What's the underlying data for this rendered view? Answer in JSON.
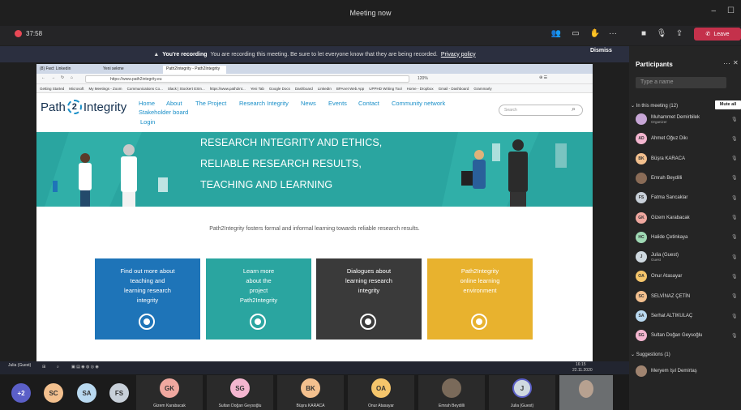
{
  "window": {
    "title": "Meeting now"
  },
  "meeting_bar": {
    "timer": "37:58",
    "leave_label": "Leave"
  },
  "banner": {
    "title": "You're recording",
    "text": "You are recording this meeting. Be sure to let everyone know that they are being recorded.",
    "link": "Privacy policy",
    "dismiss": "Dismiss"
  },
  "browser": {
    "tabs": [
      "(8) Fwd: Linkedin",
      "Yeni sekme",
      "Path2Integrity - Path2Integrity"
    ],
    "url": "https://www.path2integrity.eu",
    "zoom": "120%",
    "bookmarks": [
      "Getting Started",
      "Microsoft",
      "My Meetings - Zoom",
      "Communications Co...",
      "Slack | Stockert ESIn...",
      "https://www.path2int...",
      "Yeni Tab",
      "Google Docs",
      "Dashboard",
      "LinkedIn",
      "BPAnet Web App",
      "UPPHD Writing Tool",
      "Home - Dropbox",
      "Gmail - Dashboard",
      "Grammarly"
    ]
  },
  "site": {
    "logo_left": "Path",
    "logo_num": "2",
    "logo_right": "Integrity",
    "nav": [
      "Home",
      "About",
      "The Project",
      "Research Integrity",
      "News",
      "Events",
      "Contact",
      "Community network"
    ],
    "nav_row2": [
      "Stakeholder board"
    ],
    "nav_row3": [
      "Login"
    ],
    "search_placeholder": "Search",
    "hero_lines": [
      "RESEARCH INTEGRITY AND ETHICS,",
      "RELIABLE RESEARCH RESULTS,",
      "TEACHING AND LEARNING"
    ],
    "tagline": "Path2Integrity fosters formal and informal learning towards reliable research results.",
    "cards": [
      {
        "lines": [
          "Find out more about",
          "teaching and",
          "learning research",
          "integrity"
        ],
        "color": "#1e74b8"
      },
      {
        "lines": [
          "Learn more",
          "about the",
          "project",
          "Path2Integrity"
        ],
        "color": "#2aa5a0"
      },
      {
        "lines": [
          "Dialogues about",
          "learning research",
          "integrity"
        ],
        "color": "#3a3a3a"
      },
      {
        "lines": [
          "Path2Integrity",
          "online learning",
          "environment"
        ],
        "color": "#e8b22e"
      }
    ]
  },
  "taskbar": {
    "user": "Julia (Guest)",
    "time": "16:15",
    "date": "22.11.2020"
  },
  "bottom": {
    "more_count": "+2",
    "small_avatars": [
      {
        "i": "SC",
        "c": "#f3c08e"
      },
      {
        "i": "SA",
        "c": "#b9d9f0"
      },
      {
        "i": "FS",
        "c": "#c8d0d9"
      }
    ],
    "tiles": [
      {
        "i": "GK",
        "c": "#f0a8a0",
        "name": "Gizem Karabacak"
      },
      {
        "i": "SG",
        "c": "#f4b6d0",
        "name": "Sultan Doğan Geysoğlu"
      },
      {
        "i": "BK",
        "c": "#f3c08e",
        "name": "Büşra KARACA"
      },
      {
        "i": "OA",
        "c": "#f5c56b",
        "name": "Onur Atasayar"
      },
      {
        "i": "",
        "c": "#7a6a5a",
        "name": "Emrah Beydilli"
      },
      {
        "i": "J",
        "c": "#cfd9e0",
        "name": "Julia (Guest)"
      }
    ]
  },
  "panel": {
    "title": "Participants",
    "search_placeholder": "Type a name",
    "in_meeting": "In this meeting (12)",
    "mute_all": "Mute all",
    "people": [
      {
        "i": "",
        "c": "#c7a6d6",
        "name": "Muhammet Demirbilek",
        "role": "Organizer"
      },
      {
        "i": "AD",
        "c": "#f4b6d0",
        "name": "Ahmet Oğuz Dikı",
        "role": ""
      },
      {
        "i": "BK",
        "c": "#f3c08e",
        "name": "Büşra KARACA",
        "role": ""
      },
      {
        "i": "",
        "c": "#8a6c57",
        "name": "Emrah Beydilli",
        "role": ""
      },
      {
        "i": "FS",
        "c": "#c8d0d9",
        "name": "Fatma Sancaklar",
        "role": ""
      },
      {
        "i": "GK",
        "c": "#f0a8a0",
        "name": "Gizem Karabacak",
        "role": ""
      },
      {
        "i": "HC",
        "c": "#9fd9b4",
        "name": "Halide Çetinkaya",
        "role": ""
      },
      {
        "i": "J",
        "c": "#cfd9e0",
        "name": "Julia (Guest)",
        "role": "Guest"
      },
      {
        "i": "OA",
        "c": "#f5c56b",
        "name": "Onur Atasayar",
        "role": ""
      },
      {
        "i": "SC",
        "c": "#f3c08e",
        "name": "SELVİNAZ ÇETİN",
        "role": ""
      },
      {
        "i": "SA",
        "c": "#b9d9f0",
        "name": "Serhat ALTIKULAÇ",
        "role": ""
      },
      {
        "i": "SG",
        "c": "#f4b6d0",
        "name": "Sultan Doğan Geysoğlu",
        "role": ""
      }
    ],
    "suggestions": "Suggestions (1)",
    "suggested": {
      "i": "",
      "c": "#a08470",
      "name": "Meryem Işıl Demirtaş"
    }
  }
}
